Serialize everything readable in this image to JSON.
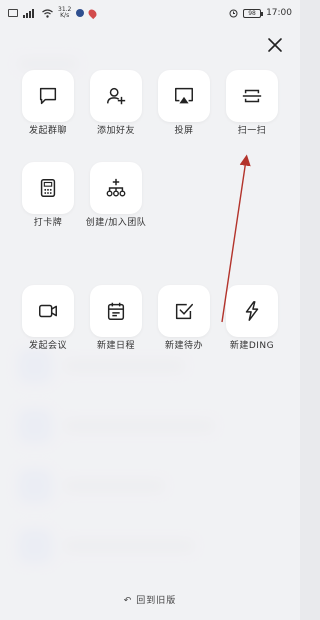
{
  "status_bar": {
    "net_speed": "31.2\nK/s",
    "battery": "98",
    "time": "17:00"
  },
  "actions": [
    {
      "label": "发起群聊",
      "icon": "chat-bubble-icon"
    },
    {
      "label": "添加好友",
      "icon": "add-user-icon"
    },
    {
      "label": "投屏",
      "icon": "screen-cast-icon"
    },
    {
      "label": "扫一扫",
      "icon": "scan-icon"
    },
    {
      "label": "打卡牌",
      "icon": "card-icon"
    },
    {
      "label": "创建/加入团队",
      "icon": "org-team-icon"
    },
    {
      "label": "发起会议",
      "icon": "video-camera-icon"
    },
    {
      "label": "新建日程",
      "icon": "calendar-icon"
    },
    {
      "label": "新建待办",
      "icon": "check-box-icon"
    },
    {
      "label": "新建DING",
      "icon": "lightning-icon"
    }
  ],
  "bottom": {
    "back_label": "回到旧版"
  },
  "colors": {
    "annotation_arrow": "#b3332b",
    "tile_bg": "#ffffff"
  }
}
